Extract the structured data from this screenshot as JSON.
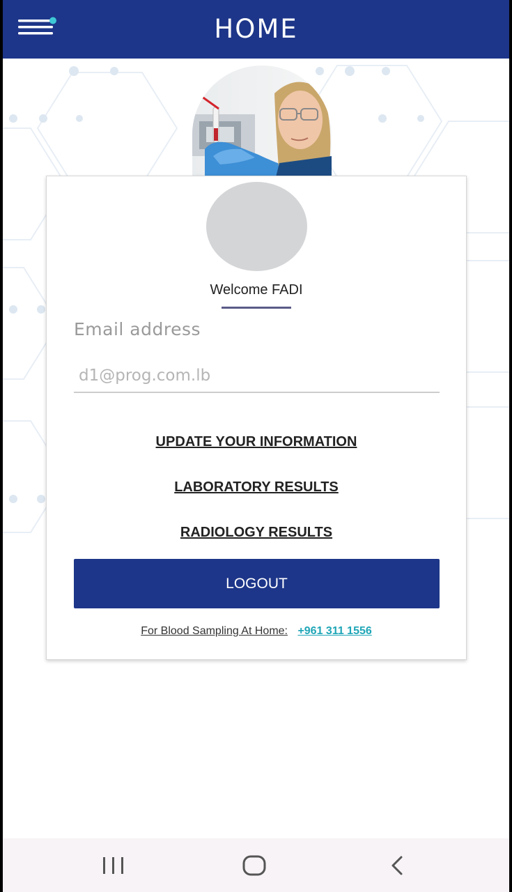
{
  "header": {
    "title": "HOME",
    "menu_icon": "menu-icon",
    "background_color": "#1d3689"
  },
  "hero": {
    "image": "lab-technician-photo"
  },
  "profile": {
    "avatar_icon": "avatar-placeholder",
    "welcome_text": "Welcome FADI"
  },
  "email": {
    "label": "Email address",
    "value": "",
    "placeholder": "d1@prog.com.lb"
  },
  "links": {
    "update_info": "UPDATE YOUR INFORMATION",
    "lab_results": "LABORATORY RESULTS",
    "radiology_results": "RADIOLOGY RESULTS"
  },
  "logout_label": "LOGOUT",
  "footer": {
    "label": "For Blood Sampling At Home:",
    "phone": "+961 311 1556",
    "phone_color": "#1fa6b7"
  },
  "system_nav": {
    "recents_icon": "recents-icon",
    "home_icon": "home-icon",
    "back_icon": "back-icon"
  }
}
